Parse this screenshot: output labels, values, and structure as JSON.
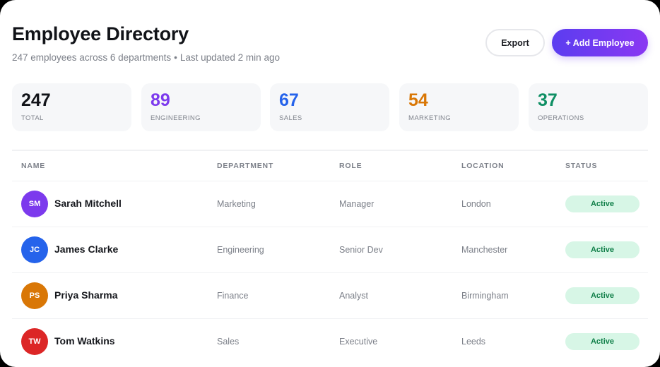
{
  "header": {
    "title": "Employee Directory",
    "subtitle_count": "247 employees across 6 departments",
    "subtitle_separator": "•",
    "subtitle_updated": "Last updated 2 min ago"
  },
  "actions": {
    "export_label": "Export",
    "add_label": "+ Add Employee"
  },
  "stats": [
    {
      "value": "247",
      "label": "TOTAL",
      "color": "#111318"
    },
    {
      "value": "89",
      "label": "ENGINEERING",
      "color": "#7c3aed"
    },
    {
      "value": "67",
      "label": "SALES",
      "color": "#2563eb"
    },
    {
      "value": "54",
      "label": "MARKETING",
      "color": "#d97706"
    },
    {
      "value": "37",
      "label": "OPERATIONS",
      "color": "#0f8f64"
    }
  ],
  "table": {
    "columns": [
      "NAME",
      "DEPARTMENT",
      "ROLE",
      "LOCATION",
      "STATUS"
    ],
    "rows": [
      {
        "initials": "SM",
        "avatar_color": "#7c3aed",
        "name": "Sarah Mitchell",
        "department": "Marketing",
        "role": "Manager",
        "location": "London",
        "status": "Active"
      },
      {
        "initials": "JC",
        "avatar_color": "#2563eb",
        "name": "James Clarke",
        "department": "Engineering",
        "role": "Senior Dev",
        "location": "Manchester",
        "status": "Active"
      },
      {
        "initials": "PS",
        "avatar_color": "#d97706",
        "name": "Priya Sharma",
        "department": "Finance",
        "role": "Analyst",
        "location": "Birmingham",
        "status": "Active"
      },
      {
        "initials": "TW",
        "avatar_color": "#dc2626",
        "name": "Tom Watkins",
        "department": "Sales",
        "role": "Executive",
        "location": "Leeds",
        "status": "Active"
      }
    ]
  }
}
